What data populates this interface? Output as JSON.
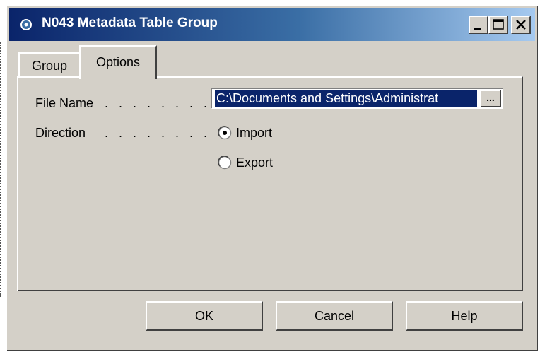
{
  "window": {
    "title": "N043 Metadata Table Group",
    "controls": {
      "minimize_icon": "minimize-icon",
      "maximize_icon": "maximize-icon",
      "close_icon": "close-icon"
    }
  },
  "tabs": [
    {
      "label": "Group",
      "selected": false
    },
    {
      "label": "Options",
      "selected": true
    }
  ],
  "form": {
    "file_name": {
      "label": "File Name",
      "dots": ". . . . . . . .",
      "value": "C:\\Documents and Settings\\Administrat",
      "browse_label": "..."
    },
    "direction": {
      "label": "Direction",
      "dots": ". . . . . . . .",
      "options": [
        {
          "label": "Import",
          "checked": true
        },
        {
          "label": "Export",
          "checked": false
        }
      ]
    }
  },
  "buttons": {
    "ok": "OK",
    "cancel": "Cancel",
    "help": "Help"
  },
  "colors": {
    "titlebar_start": "#0a246a",
    "titlebar_end": "#a6caf0",
    "face": "#d4d0c8",
    "selection": "#0a246a"
  }
}
